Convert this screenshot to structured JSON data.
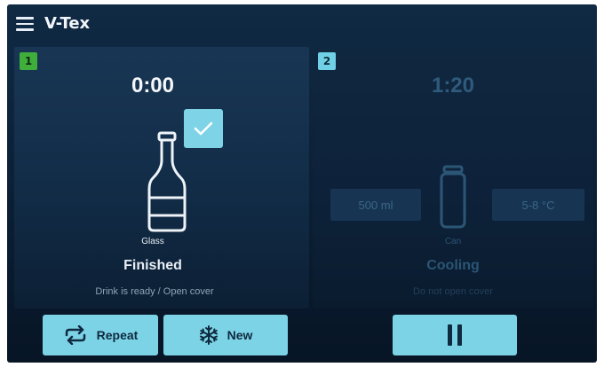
{
  "app": {
    "title": "V-Tex"
  },
  "icons": {
    "menu": "hamburger-menu-icon",
    "check": "checkmark-icon",
    "bottle": "glass-bottle-icon",
    "can": "can-icon",
    "repeat": "repeat-icon",
    "new": "snowflake-icon",
    "pause": "pause-icon"
  },
  "colors": {
    "accent": "#7dd3e6",
    "badge_active": "#3fae3b",
    "background": "#0c2138"
  },
  "slot1": {
    "number": "1",
    "timer": "0:00",
    "container_label": "Glass",
    "status": "Finished",
    "hint": "Drink is ready / Open cover"
  },
  "slot2": {
    "number": "2",
    "timer": "1:20",
    "volume": "500 ml",
    "temperature": "5-8 °C",
    "container_label": "Can",
    "status": "Cooling",
    "hint": "Do not open cover"
  },
  "buttons": {
    "repeat_label": "Repeat",
    "new_label": "New"
  }
}
